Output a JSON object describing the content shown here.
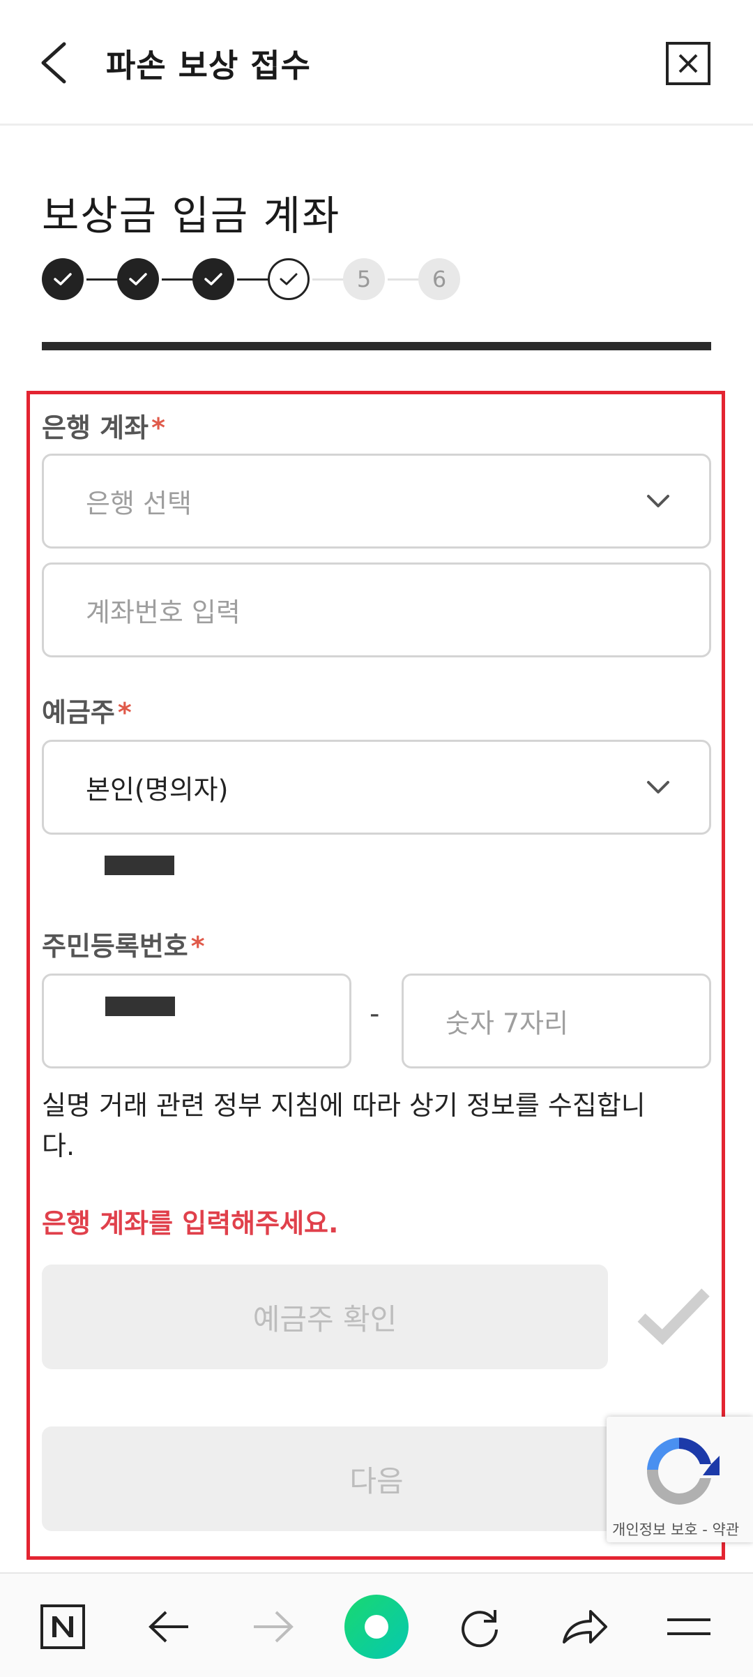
{
  "header": {
    "title": "파손 보상 접수"
  },
  "page": {
    "title": "보상금 입금 계좌"
  },
  "steps": {
    "items": [
      {
        "label": "",
        "state": "done"
      },
      {
        "label": "",
        "state": "done"
      },
      {
        "label": "",
        "state": "done"
      },
      {
        "label": "",
        "state": "current"
      },
      {
        "label": "5",
        "state": "todo"
      },
      {
        "label": "6",
        "state": "todo"
      }
    ]
  },
  "form": {
    "bank_account_label": "은행 계좌",
    "required_mark": "*",
    "bank_select_placeholder": "은행 선택",
    "account_number_placeholder": "계좌번호 입력",
    "depositor_label": "예금주",
    "depositor_value": "본인(명의자)",
    "rrn_label": "주민등록번호",
    "rrn_dash": "-",
    "rrn_back_placeholder": "숫자 7자리",
    "notice": "실명 거래 관련 정부 지침에 따라 상기 정보를 수집합니다.",
    "error_message": "은행 계좌를 입력해주세요.",
    "verify_button": "예금주 확인",
    "next_button": "다음"
  },
  "recaptcha": {
    "footer_text": "개인정보 보호 - 약관"
  },
  "colors": {
    "accent_red": "#e32431",
    "error_text": "#e0404b",
    "disabled_bg": "#eeeeee",
    "browser_green": "#19d870"
  },
  "bottom_nav": {
    "icons": [
      "naver-n-icon",
      "back-arrow-icon",
      "forward-arrow-icon",
      "green-dot-icon",
      "refresh-icon",
      "share-icon",
      "menu-icon"
    ]
  }
}
